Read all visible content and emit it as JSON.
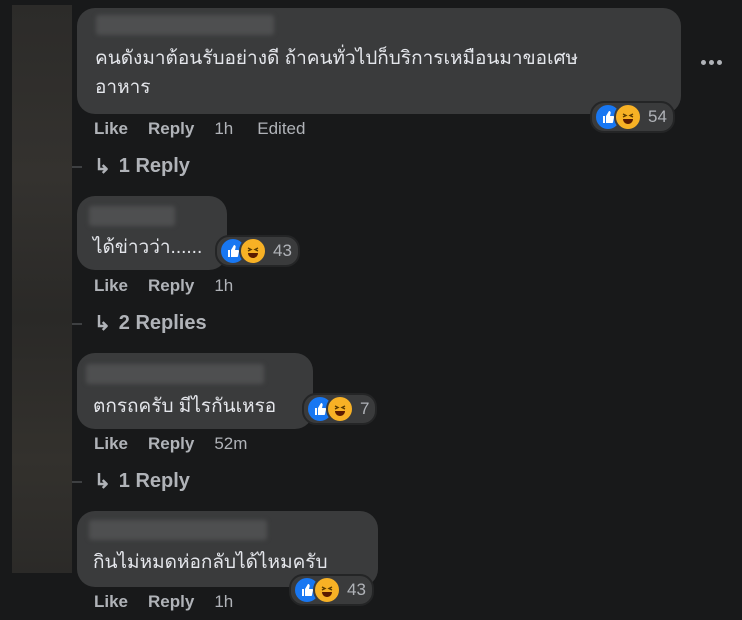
{
  "comments": [
    {
      "text_lines": [
        "คนดังมาต้อนรับอย่างดี ถ้าคนทั่วไปก็บริการเหมือนมาขอเศษ",
        "อาหาร"
      ],
      "reactions": {
        "icons": [
          "like-icon",
          "haha-icon"
        ],
        "count": "54"
      },
      "actions": {
        "like": "Like",
        "reply": "Reply",
        "time": "1h",
        "edited": "Edited"
      },
      "replies": "1 Reply"
    },
    {
      "text_lines": [
        "ได้ข่าวว่า......"
      ],
      "reactions": {
        "icons": [
          "like-icon",
          "haha-icon"
        ],
        "count": "43"
      },
      "actions": {
        "like": "Like",
        "reply": "Reply",
        "time": "1h"
      },
      "replies": "2 Replies"
    },
    {
      "text_lines": [
        "ตกรถครับ มีไรกันเหรอ"
      ],
      "reactions": {
        "icons": [
          "like-icon",
          "haha-icon"
        ],
        "count": "7"
      },
      "actions": {
        "like": "Like",
        "reply": "Reply",
        "time": "52m"
      },
      "replies": "1 Reply"
    },
    {
      "text_lines": [
        "กินไม่หมดห่อกลับได้ไหมครับ"
      ],
      "reactions": {
        "icons": [
          "like-icon",
          "haha-icon"
        ],
        "count": "43"
      },
      "actions": {
        "like": "Like",
        "reply": "Reply",
        "time": "1h"
      }
    }
  ],
  "reply_arrow": "↳",
  "colors": {
    "background": "#18191a",
    "bubble": "#3a3b3c",
    "text": "#e4e6eb",
    "muted": "#b0b3b8",
    "like_blue": "#1877f2",
    "haha_yellow": "#f7b125"
  }
}
